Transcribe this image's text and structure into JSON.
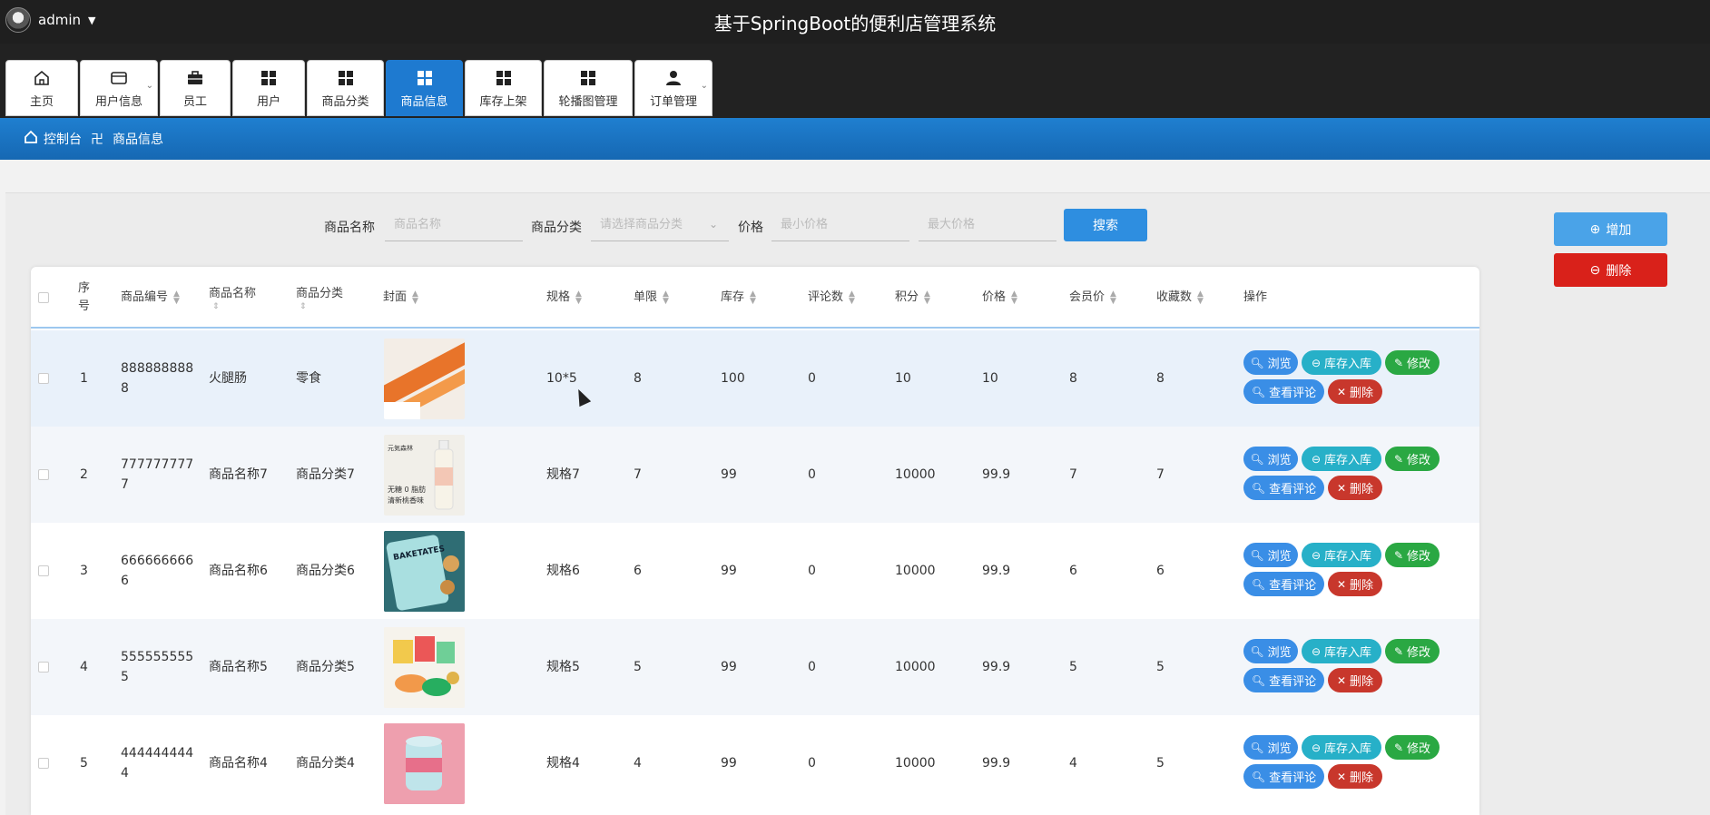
{
  "header": {
    "user": "admin",
    "title": "基于SpringBoot的便利店管理系统"
  },
  "nav": {
    "tabs": [
      {
        "label": "主页",
        "icon": "home-icon"
      },
      {
        "label": "用户信息",
        "icon": "card-icon",
        "has_sub": true
      },
      {
        "label": "员工",
        "icon": "briefcase-icon"
      },
      {
        "label": "用户",
        "icon": "grid-icon"
      },
      {
        "label": "商品分类",
        "icon": "grid-icon"
      },
      {
        "label": "商品信息",
        "icon": "grid-icon",
        "active": true
      },
      {
        "label": "库存上架",
        "icon": "grid-icon"
      },
      {
        "label": "轮播图管理",
        "icon": "grid-icon"
      },
      {
        "label": "订单管理",
        "icon": "person-icon",
        "has_sub": true
      }
    ]
  },
  "breadcrumb": {
    "home": "控制台",
    "sep": "卍",
    "current": "商品信息"
  },
  "search": {
    "name_label": "商品名称",
    "name_placeholder": "商品名称",
    "category_label": "商品分类",
    "category_placeholder": "请选择商品分类",
    "price_label": "价格",
    "min_placeholder": "最小价格",
    "max_placeholder": "最大价格",
    "search_button": "搜索"
  },
  "actions": {
    "add": "增加",
    "delete": "删除"
  },
  "table": {
    "headers": [
      "序号",
      "商品编号",
      "商品名称",
      "商品分类",
      "封面",
      "规格",
      "单限",
      "库存",
      "评论数",
      "积分",
      "价格",
      "会员价",
      "收藏数",
      "操作"
    ],
    "ops": {
      "view": "浏览",
      "stock_in": "库存入库",
      "edit": "修改",
      "comments": "查看评论",
      "remove": "删除"
    },
    "rows": [
      {
        "no": "1",
        "code": "888888888",
        "code2": "8",
        "name": "火腿肠",
        "category": "零食",
        "spec": "10*5",
        "limit": "8",
        "stock": "100",
        "comments": "0",
        "points": "10",
        "price": "10",
        "member_price": "8",
        "favorites": "8"
      },
      {
        "no": "2",
        "code": "777777777",
        "code2": "7",
        "name": "商品名称7",
        "category": "商品分类7",
        "spec": "规格7",
        "limit": "7",
        "stock": "99",
        "comments": "0",
        "points": "10000",
        "price": "99.9",
        "member_price": "7",
        "favorites": "7"
      },
      {
        "no": "3",
        "code": "666666666",
        "code2": "6",
        "name": "商品名称6",
        "category": "商品分类6",
        "spec": "规格6",
        "limit": "6",
        "stock": "99",
        "comments": "0",
        "points": "10000",
        "price": "99.9",
        "member_price": "6",
        "favorites": "6"
      },
      {
        "no": "4",
        "code": "555555555",
        "code2": "5",
        "name": "商品名称5",
        "category": "商品分类5",
        "spec": "规格5",
        "limit": "5",
        "stock": "99",
        "comments": "0",
        "points": "10000",
        "price": "99.9",
        "member_price": "5",
        "favorites": "5"
      },
      {
        "no": "5",
        "code": "444444444",
        "code2": "4",
        "name": "商品名称4",
        "category": "商品分类4",
        "spec": "规格4",
        "limit": "4",
        "stock": "99",
        "comments": "0",
        "points": "10000",
        "price": "99.9",
        "member_price": "4",
        "favorites": "5"
      }
    ]
  },
  "thumb_text": {
    "row2_line1": "元気森林",
    "row2_line2": "无糖 0 脂肪",
    "row2_line3": "清新桃香味",
    "row3_brand": "BAKETATES"
  },
  "colors": {
    "nav_active": "#1e7ad0",
    "primary": "#3a8ee6",
    "danger": "#d9211a",
    "success": "#2aa843",
    "info": "#27b0c8"
  }
}
